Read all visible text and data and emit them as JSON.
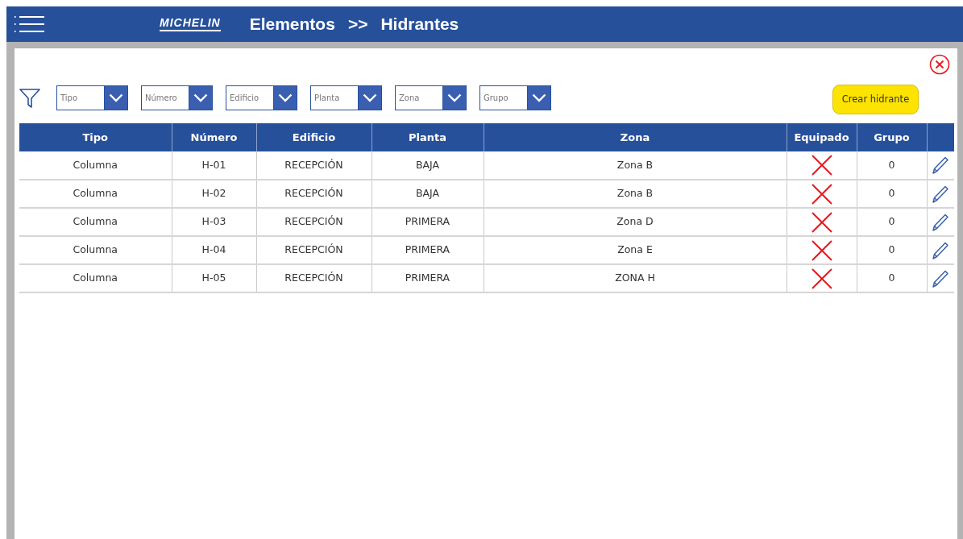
{
  "header": {
    "logo_text": "MICHELIN",
    "breadcrumb": [
      {
        "label": "Elementos"
      },
      {
        "label": ">>"
      },
      {
        "label": "Hidrantes"
      }
    ]
  },
  "filters": [
    {
      "placeholder": "Tipo"
    },
    {
      "placeholder": "Número"
    },
    {
      "placeholder": "Edificio"
    },
    {
      "placeholder": "Planta"
    },
    {
      "placeholder": "Zona"
    },
    {
      "placeholder": "Grupo"
    }
  ],
  "create_button": "Crear hidrante",
  "table": {
    "columns": [
      "Tipo",
      "Número",
      "Edificio",
      "Planta",
      "Zona",
      "Equipado",
      "Grupo"
    ],
    "rows": [
      {
        "tipo": "Columna",
        "numero": "H-01",
        "edificio": "RECEPCIÓN",
        "planta": "BAJA",
        "zona": "Zona B",
        "equipado": false,
        "grupo": "0"
      },
      {
        "tipo": "Columna",
        "numero": "H-02",
        "edificio": "RECEPCIÓN",
        "planta": "BAJA",
        "zona": "Zona B",
        "equipado": false,
        "grupo": "0"
      },
      {
        "tipo": "Columna",
        "numero": "H-03",
        "edificio": "RECEPCIÓN",
        "planta": "PRIMERA",
        "zona": "Zona D",
        "equipado": false,
        "grupo": "0"
      },
      {
        "tipo": "Columna",
        "numero": "H-04",
        "edificio": "RECEPCIÓN",
        "planta": "PRIMERA",
        "zona": "Zona E",
        "equipado": false,
        "grupo": "0"
      },
      {
        "tipo": "Columna",
        "numero": "H-05",
        "edificio": "RECEPCIÓN",
        "planta": "PRIMERA",
        "zona": "ZONA H",
        "equipado": false,
        "grupo": "0"
      }
    ]
  }
}
